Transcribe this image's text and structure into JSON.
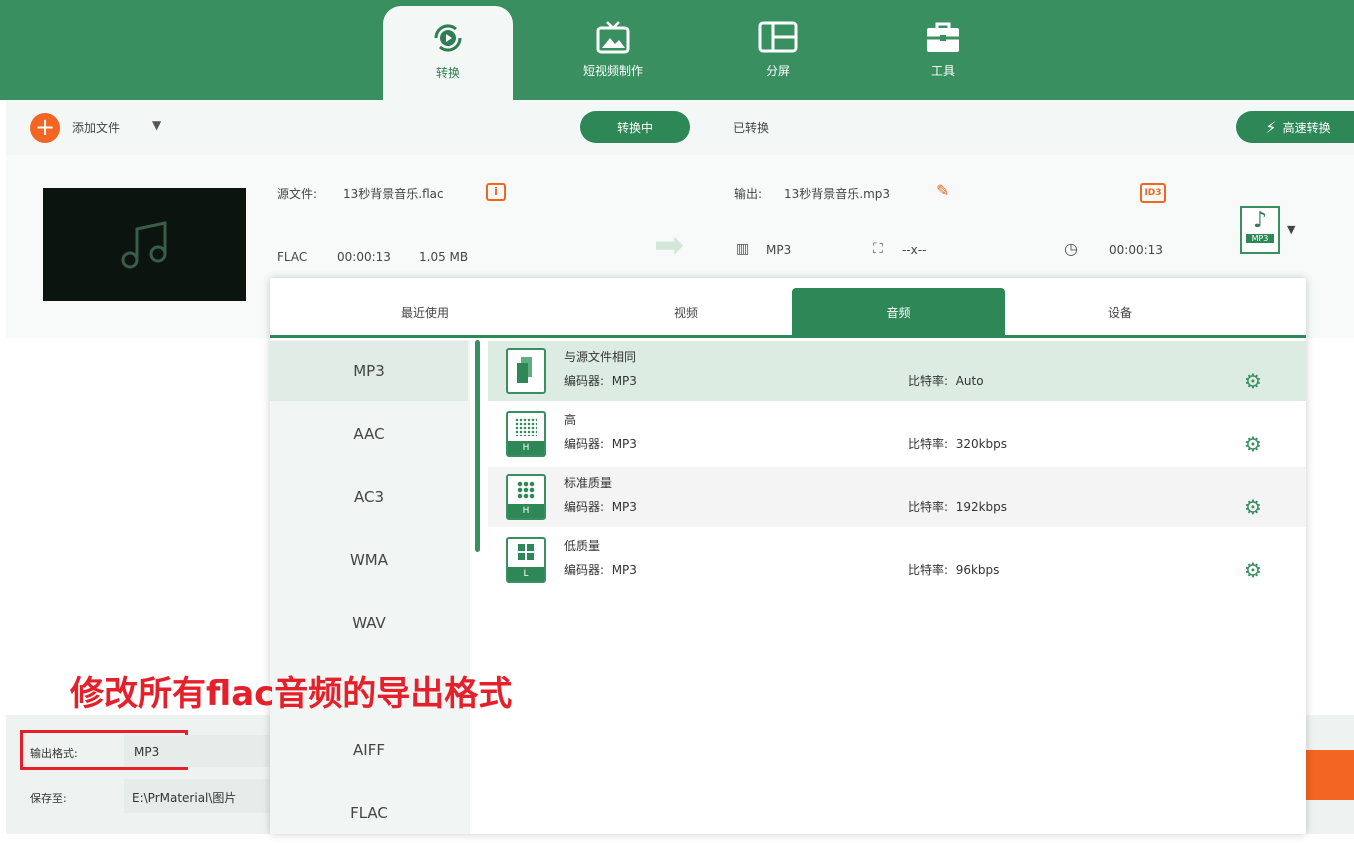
{
  "nav": {
    "tabs": [
      {
        "label": "转换",
        "icon": "convert-icon"
      },
      {
        "label": "短视频制作",
        "icon": "tv-icon"
      },
      {
        "label": "分屏",
        "icon": "split-screen-icon"
      },
      {
        "label": "工具",
        "icon": "toolbox-icon"
      }
    ]
  },
  "toolbar": {
    "add_file": "添加文件",
    "converting": "转换中",
    "converted": "已转换",
    "fast_convert": "高速转换"
  },
  "file": {
    "source_label": "源文件:",
    "source_name": "13秒背景音乐.flac",
    "format": "FLAC",
    "duration": "00:00:13",
    "size": "1.05 MB",
    "output_label": "输出:",
    "output_name": "13秒背景音乐.mp3",
    "out_format": "MP3",
    "resolution": "--x--",
    "out_duration": "00:00:13",
    "format_badge": "MP3",
    "id3_badge": "ID3"
  },
  "panel": {
    "tabs": [
      "最近使用",
      "视频",
      "音频",
      "设备"
    ],
    "active_tab": "音频",
    "formats": [
      "MP3",
      "AAC",
      "AC3",
      "WMA",
      "WAV",
      "AIFF",
      "FLAC"
    ],
    "selected_format": "MP3",
    "presets": [
      {
        "name": "与源文件相同",
        "encoder_label": "编码器:",
        "encoder": "MP3",
        "bitrate_label": "比特率:",
        "bitrate": "Auto",
        "badge": ""
      },
      {
        "name": "高",
        "encoder_label": "编码器:",
        "encoder": "MP3",
        "bitrate_label": "比特率:",
        "bitrate": "320kbps",
        "badge": "H"
      },
      {
        "name": "标准质量",
        "encoder_label": "编码器:",
        "encoder": "MP3",
        "bitrate_label": "比特率:",
        "bitrate": "192kbps",
        "badge": "H"
      },
      {
        "name": "低质量",
        "encoder_label": "编码器:",
        "encoder": "MP3",
        "bitrate_label": "比特率:",
        "bitrate": "96kbps",
        "badge": "L"
      }
    ]
  },
  "bottom": {
    "output_format_label": "输出格式:",
    "output_format": "MP3",
    "save_to_label": "保存至:",
    "save_path": "E:\\PrMaterial\\图片"
  },
  "annotation": "修改所有flac音频的导出格式",
  "colors": {
    "brand": "#3a8f60",
    "accent": "#f26522",
    "annotation": "#e5202a"
  }
}
